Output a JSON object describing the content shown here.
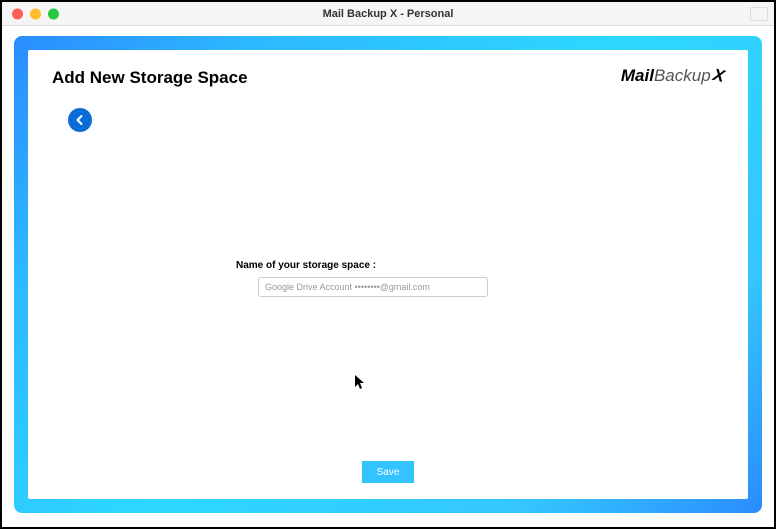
{
  "window": {
    "title": "Mail Backup X - Personal"
  },
  "page": {
    "title": "Add New Storage Space"
  },
  "logo": {
    "mail": "Mail",
    "backup": "Backup",
    "x": "X"
  },
  "form": {
    "name_label": "Name of your storage space :",
    "name_value": "Google Drive Account ••••••••@gmail.com"
  },
  "actions": {
    "save_label": "Save"
  }
}
